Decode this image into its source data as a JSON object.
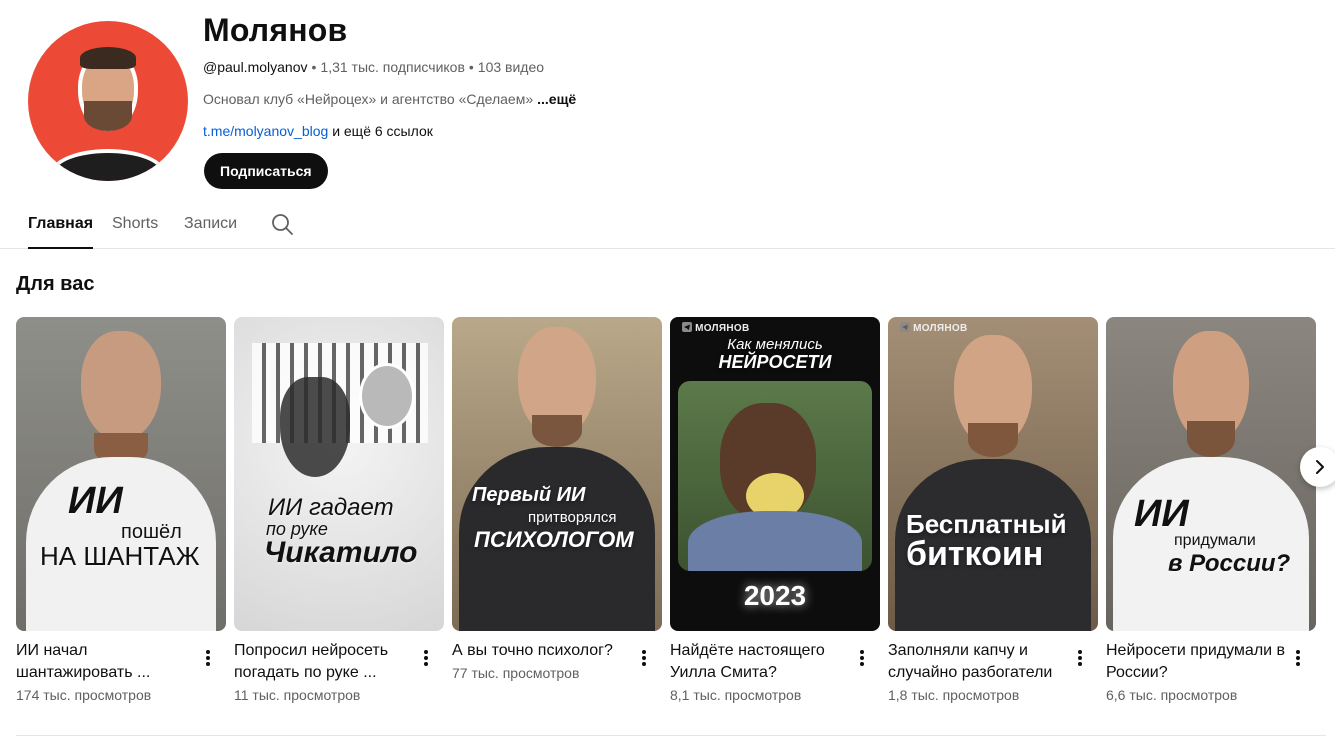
{
  "channel": {
    "name": "Молянов",
    "handle": "@paul.molyanov",
    "subscribers": "1,31 тыс. подписчиков",
    "video_count": "103 видео",
    "description": "Основал клуб «Нейроцех» и агентство «Сделаем»",
    "description_more": "...ещё",
    "link": "t.me/molyanov_blog",
    "more_links": "и ещё 6 ссылок",
    "subscribe_label": "Подписаться"
  },
  "tabs": [
    {
      "label": "Главная",
      "active": true
    },
    {
      "label": "Shorts",
      "active": false
    },
    {
      "label": "Записи",
      "active": false
    }
  ],
  "section": {
    "title": "Для вас"
  },
  "videos": [
    {
      "title": "ИИ начал шантажировать ...",
      "views": "174 тыс. просмотров",
      "overlay": [
        "ИИ",
        "пошёл",
        "НА ШАНТАЖ"
      ]
    },
    {
      "title": "Попросил нейросеть погадать по руке ...",
      "views": "11 тыс. просмотров",
      "overlay": [
        "ИИ гадает",
        "по руке",
        "Чикатило"
      ]
    },
    {
      "title": "А вы точно психолог?",
      "views": "77 тыс. просмотров",
      "overlay": [
        "Первый ИИ",
        "притворялся",
        "ПСИХОЛОГОМ"
      ]
    },
    {
      "title": "Найдёте настоящего Уилла Смита?",
      "views": "8,1 тыс. просмотров",
      "overlay": [
        "Как менялись",
        "НЕЙРОСЕТИ",
        "2023"
      ],
      "brand": "МОЛЯНОВ"
    },
    {
      "title": "Заполняли капчу и случайно разбогатели",
      "views": "1,8 тыс. просмотров",
      "overlay": [
        "Бесплатный",
        "биткоин"
      ],
      "brand": "МОЛЯНОВ"
    },
    {
      "title": "Нейросети придумали в России?",
      "views": "6,6 тыс. просмотров",
      "overlay": [
        "ИИ",
        "придумали",
        "в России?"
      ]
    }
  ],
  "colors": {
    "avatar_bg": "#ec4a37",
    "link": "#065fd4",
    "subscribe_bg": "#0f0f0f",
    "secondary_text": "#606060"
  },
  "icons": {
    "search": "search-icon",
    "more": "more-vert-icon",
    "next": "chevron-right-icon",
    "telegram": "telegram-icon"
  }
}
